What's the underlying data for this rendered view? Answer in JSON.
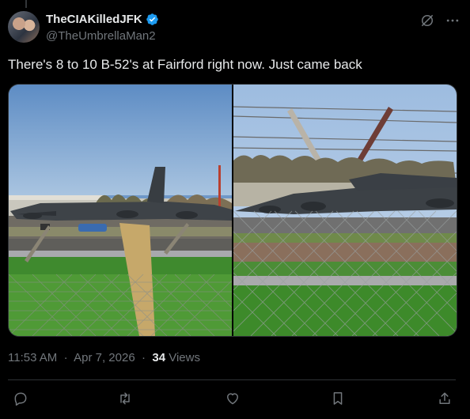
{
  "author": {
    "display_name": "TheCIAKilledJFK",
    "handle": "@TheUmbrellaMan2",
    "verified": true
  },
  "tweet": {
    "text": "There's 8 to 10 B-52's at Fairford right now. Just came back",
    "time": "11:53 AM",
    "date": "Apr 7, 2026",
    "views_count": "34",
    "views_label": "Views"
  },
  "icons": {
    "grok": "grok-icon",
    "more": "more-icon",
    "reply": "reply-icon",
    "repost": "repost-icon",
    "like": "like-icon",
    "bookmark": "bookmark-icon",
    "share": "share-icon"
  },
  "colors": {
    "background": "#000000",
    "text": "#e7e9ea",
    "secondary": "#71767b",
    "verified": "#1d9bf0",
    "border": "#2f3336"
  }
}
